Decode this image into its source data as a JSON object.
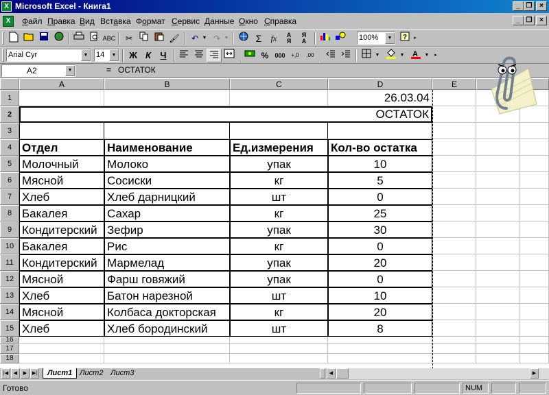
{
  "window": {
    "title": "Microsoft Excel - Книга1"
  },
  "menubar": {
    "items": [
      {
        "pre": "",
        "key": "Ф",
        "post": "айл"
      },
      {
        "pre": "",
        "key": "П",
        "post": "равка"
      },
      {
        "pre": "",
        "key": "В",
        "post": "ид"
      },
      {
        "pre": "Вст",
        "key": "а",
        "post": "вка"
      },
      {
        "pre": "Ф",
        "key": "о",
        "post": "рмат"
      },
      {
        "pre": "",
        "key": "С",
        "post": "ервис"
      },
      {
        "pre": "",
        "key": "Д",
        "post": "анные"
      },
      {
        "pre": "",
        "key": "О",
        "post": "кно"
      },
      {
        "pre": "",
        "key": "С",
        "post": "правка"
      }
    ]
  },
  "toolbar": {
    "zoom": "100%",
    "sum_glyph": "Σ",
    "fx_glyph": "fx"
  },
  "format": {
    "font": "Arial Cyr",
    "size": "14",
    "bold": "Ж",
    "italic": "К",
    "underline": "Ч",
    "percent": "%",
    "thousands": "000",
    "inc_decimal": "+,0",
    "dec_decimal": ",00"
  },
  "formula_bar": {
    "cell_ref": "A2",
    "equals": "=",
    "content": "ОСТАТОК"
  },
  "sheet": {
    "columns": [
      "A",
      "B",
      "C",
      "D",
      "E"
    ],
    "rows": [
      "1",
      "2",
      "3",
      "4",
      "5",
      "6",
      "7",
      "8",
      "9",
      "10",
      "11",
      "12",
      "13",
      "14",
      "15",
      "16",
      "17",
      "18"
    ],
    "date": "26.03.04",
    "title": "ОСТАТОК",
    "headers": [
      "Отдел",
      "Наименование",
      "Ед.измерения",
      "Кол-во остатка"
    ],
    "data": [
      [
        "Молочный",
        "Молоко",
        "упак",
        "10"
      ],
      [
        "Мясной",
        "Сосиски",
        "кг",
        "5"
      ],
      [
        "Хлеб",
        "Хлеб дарницкий",
        "шт",
        "0"
      ],
      [
        "Бакалея",
        "Сахар",
        "кг",
        "25"
      ],
      [
        "Кондитерский",
        "Зефир",
        "упак",
        "30"
      ],
      [
        "Бакалея",
        "Рис",
        "кг",
        "0"
      ],
      [
        "Кондитерский",
        "Мармелад",
        "упак",
        "20"
      ],
      [
        "Мясной",
        "Фарш говяжий",
        "упак",
        "0"
      ],
      [
        "Хлеб",
        "Батон нарезной",
        "шт",
        "10"
      ],
      [
        "Мясной",
        "Колбаса докторская",
        "кг",
        "20"
      ],
      [
        "Хлеб",
        "Хлеб бородинский",
        "шт",
        "8"
      ]
    ]
  },
  "tabs": [
    "Лист1",
    "Лист2",
    "Лист3"
  ],
  "status": {
    "text": "Готово",
    "num": "NUM"
  }
}
